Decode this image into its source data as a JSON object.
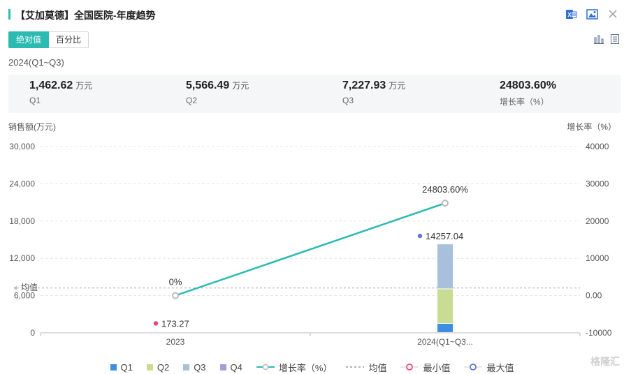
{
  "header": {
    "title": "【艾加莫德】全国医院-年度趋势",
    "icons": [
      "excel-export-icon",
      "image-export-icon",
      "close-icon"
    ]
  },
  "toggle": {
    "absolute_label": "绝对值",
    "percent_label": "百分比",
    "selected": "绝对值"
  },
  "view_icons": [
    "bar-chart-icon",
    "table-view-icon"
  ],
  "period": "2024(Q1~Q3)",
  "summary": [
    {
      "value": "1,462.62",
      "unit": "万元",
      "label": "Q1"
    },
    {
      "value": "5,566.49",
      "unit": "万元",
      "label": "Q2"
    },
    {
      "value": "7,227.93",
      "unit": "万元",
      "label": "Q3"
    },
    {
      "value": "24803.60%",
      "unit": "",
      "label": "增长率（%）"
    }
  ],
  "colors": {
    "accent": "#2bbbb2",
    "Q1": "#3d8ee0",
    "Q2": "#c9dc93",
    "Q3": "#a8c0dc",
    "Q4": "#a99ad8",
    "growth": "#2bbbb2",
    "min": "#e8467c",
    "max": "#5b79d6",
    "avg": "#999999"
  },
  "chart_data": {
    "type": "bar",
    "stacked": true,
    "categories": [
      "2023",
      "2024(Q1~Q3..."
    ],
    "series": [
      {
        "name": "Q1",
        "values": [
          null,
          1462.62
        ]
      },
      {
        "name": "Q2",
        "values": [
          null,
          5566.49
        ]
      },
      {
        "name": "Q3",
        "values": [
          null,
          7227.93
        ]
      },
      {
        "name": "Q4",
        "values": [
          null,
          null
        ]
      }
    ],
    "line_series": {
      "name": "增长率（%）",
      "values": [
        0,
        24803.6
      ],
      "labels": [
        "0%",
        "24803.60%"
      ],
      "axis": "right"
    },
    "min_point": {
      "category": "2023",
      "value": 173.27,
      "label": "173.27"
    },
    "max_point": {
      "category": "2024(Q1~Q3...",
      "value": 14257.04,
      "label": "14257.04"
    },
    "average_label": "均值",
    "ylabel_left": "销售额(万元)",
    "ylabel_right": "增长率（%）",
    "ylim_left": [
      0,
      30000
    ],
    "yticks_left": [
      "30,000",
      "24,000",
      "18,000",
      "12,000",
      "6,000",
      "0"
    ],
    "ylim_right": [
      -10000,
      40000
    ],
    "yticks_right": [
      "40000",
      "30000",
      "20000",
      "10000",
      "0.00",
      "-10000"
    ],
    "grid": true,
    "legend_position": "bottom"
  },
  "legend": [
    {
      "label": "Q1",
      "kind": "square",
      "color_key": "Q1"
    },
    {
      "label": "Q2",
      "kind": "square",
      "color_key": "Q2"
    },
    {
      "label": "Q3",
      "kind": "square",
      "color_key": "Q3"
    },
    {
      "label": "Q4",
      "kind": "square",
      "color_key": "Q4"
    },
    {
      "label": "增长率（%）",
      "kind": "line",
      "color_key": "growth"
    },
    {
      "label": "均值",
      "kind": "dash",
      "color_key": "avg"
    },
    {
      "label": "最小值",
      "kind": "circle",
      "color_key": "min"
    },
    {
      "label": "最大值",
      "kind": "circle",
      "color_key": "max"
    }
  ],
  "watermark": "格隆汇"
}
